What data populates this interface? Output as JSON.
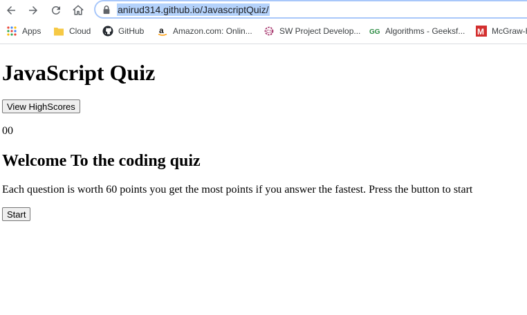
{
  "browser": {
    "url": "anirud314.github.io/JavascriptQuiz/",
    "bookmarks": [
      {
        "label": "Apps",
        "icon": "apps-grid-icon"
      },
      {
        "label": "Cloud",
        "icon": "folder-icon"
      },
      {
        "label": "GitHub",
        "icon": "github-icon"
      },
      {
        "label": "Amazon.com: Onlin...",
        "icon": "amazon-icon"
      },
      {
        "label": "SW Project Develop...",
        "icon": "sw-project-icon"
      },
      {
        "label": "Algorithms - Geeksf...",
        "icon": "geeksforgeeks-icon"
      },
      {
        "label": "McGraw-H",
        "icon": "mcgraw-hill-icon"
      }
    ]
  },
  "page": {
    "title": "JavaScript Quiz",
    "highscores_button": "View HighScores",
    "timer": "00",
    "heading": "Welcome To the coding quiz",
    "description": "Each question is worth 60 points you get the most points if you answer the fastest. Press the button to start",
    "start_button": "Start"
  },
  "colors": {
    "url_highlight": "#b4d2fb",
    "omnibox_border": "#a8c7fa",
    "button_bg": "#efefef"
  }
}
